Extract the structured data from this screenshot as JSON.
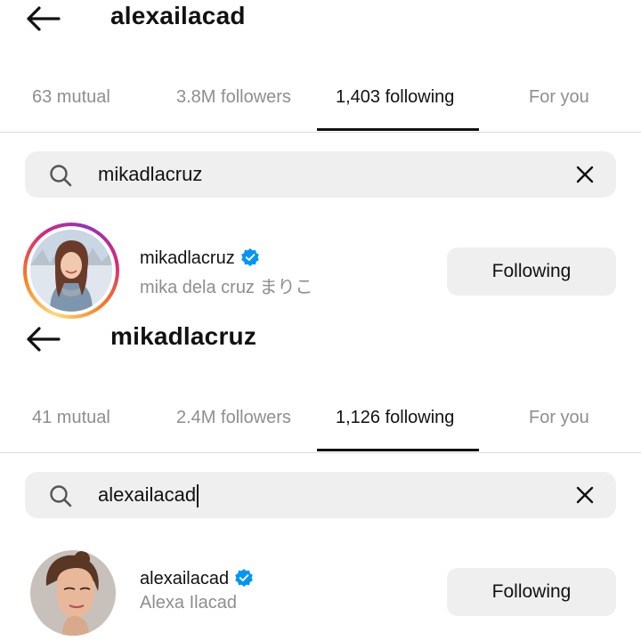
{
  "panels": [
    {
      "title": "alexailacad",
      "tabs": [
        {
          "label": "63 mutual",
          "active": false
        },
        {
          "label": "3.8M followers",
          "active": false
        },
        {
          "label": "1,403 following",
          "active": true
        },
        {
          "label": "For you",
          "active": false
        }
      ],
      "search": {
        "value": "mikadlacruz",
        "icon": "search-icon",
        "clear_icon": "close-icon"
      },
      "result": {
        "username": "mikadlacruz",
        "verified": true,
        "full_name": "mika dela cruz まりこ",
        "button_label": "Following",
        "has_story_ring": true
      }
    },
    {
      "title": "mikadlacruz",
      "tabs": [
        {
          "label": "41 mutual",
          "active": false
        },
        {
          "label": "2.4M followers",
          "active": false
        },
        {
          "label": "1,126 following",
          "active": true
        },
        {
          "label": "For you",
          "active": false
        }
      ],
      "search": {
        "value": "alexailacad",
        "icon": "search-icon",
        "clear_icon": "close-icon",
        "cursor_visible": true
      },
      "result": {
        "username": "alexailacad",
        "verified": true,
        "full_name": "Alexa Ilacad",
        "button_label": "Following",
        "has_story_ring": false
      }
    }
  ],
  "colors": {
    "verified_badge": "#0095f6",
    "muted_text": "#8e8e8e",
    "button_bg": "#efefef"
  }
}
